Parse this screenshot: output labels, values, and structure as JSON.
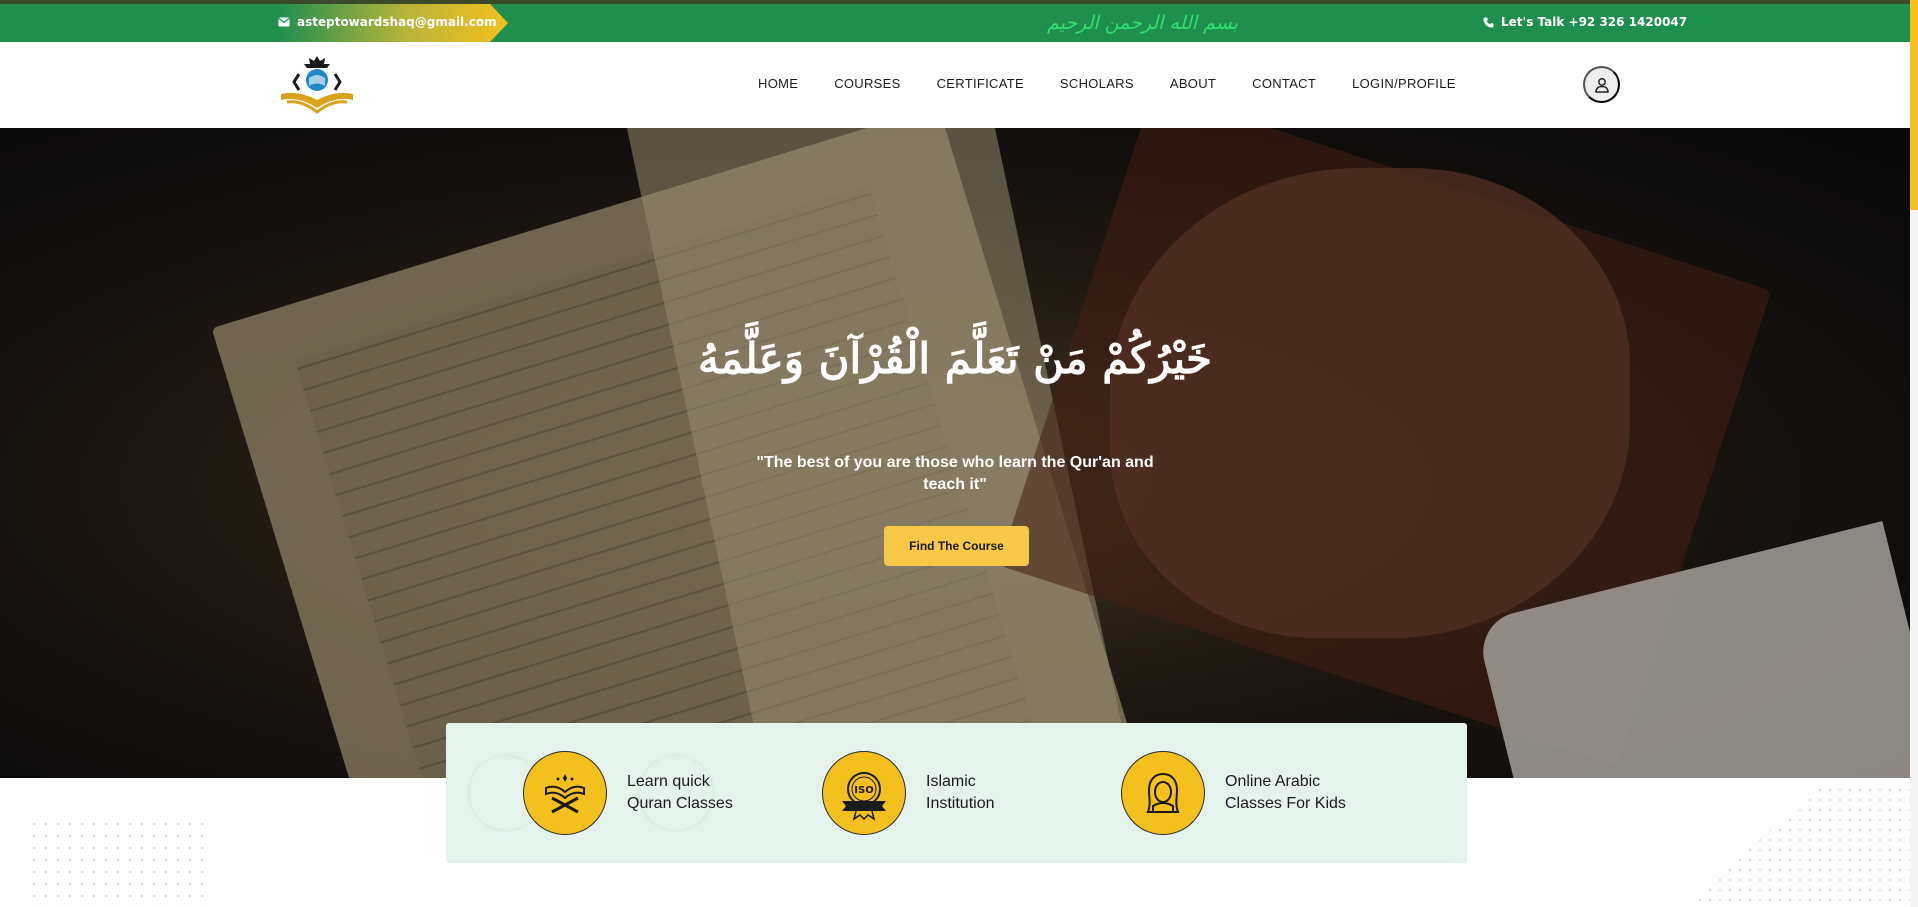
{
  "topbar": {
    "email": "asteptowardshaq@gmail.com",
    "bismillah": "بسم الله الرحمن الرحيم",
    "phone": "Let's Talk +92 326 1420047"
  },
  "nav": {
    "items": [
      "HOME",
      "COURSES",
      "CERTIFICATE",
      "SCHOLARS",
      "ABOUT",
      "CONTACT",
      "LOGIN/PROFILE"
    ]
  },
  "hero": {
    "arabic": "خَيْرُكُمْ مَنْ تَعَلَّمَ الْقُرْآنَ وَعَلَّمَهُ",
    "quote": "\"The best of you are those who learn the Qur'an and teach it\"",
    "cta_label": "Find The Course"
  },
  "features": [
    {
      "line1": "Learn quick",
      "line2": "Quran Classes",
      "icon": "quran-stand-icon"
    },
    {
      "line1": "Islamic",
      "line2": "Institution",
      "icon": "iso-badge-icon"
    },
    {
      "line1": "Online Arabic",
      "line2": "Classes For Kids",
      "icon": "hijab-girl-icon"
    }
  ],
  "colors": {
    "topbar_green": "#1f8f4e",
    "accent_yellow": "#f3c01d",
    "cta_yellow": "#f9c848",
    "features_bg": "#e5f3ed"
  }
}
